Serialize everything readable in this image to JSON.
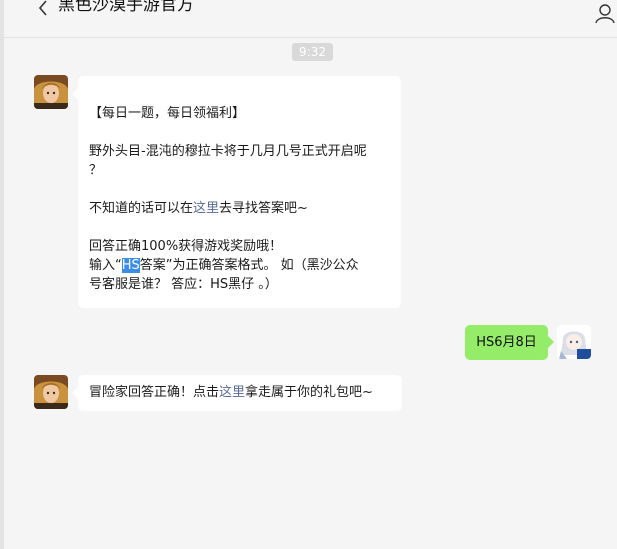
{
  "header": {
    "title": "黑色沙漠手游官方",
    "back_icon": "chevron-left-icon",
    "profile_icon": "person-icon"
  },
  "chat": {
    "timestamp": "9:32",
    "message1": {
      "line1": "【每日一题，每日领福利】",
      "line2a": "野外头目-混沌的穆拉卡将于几月几号正式开启呢",
      "line2b": "？",
      "line3_pre": "不知道的话可以在",
      "line3_link": "这里",
      "line3_post": "去寻找答案吧~",
      "line4": "回答正确100%获得游戏奖励哦！",
      "line5_pre": "输入“",
      "line5_hl": "HS",
      "line5_post": "答案”为正确答案格式。 如（黑沙公众",
      "line6": "号客服是谁？ 答应：HS黑仔 。）"
    },
    "reply": {
      "text": "HS6月8日"
    },
    "message2": {
      "pre": "冒险家回答正确！点击",
      "link": "这里",
      "post": "拿走属于你的礼包吧~"
    }
  },
  "colors": {
    "background": "#f5f5f5",
    "bubble_incoming": "#ffffff",
    "bubble_outgoing": "#95ec69",
    "link": "#576b95",
    "highlight": "#3a8ee6"
  }
}
